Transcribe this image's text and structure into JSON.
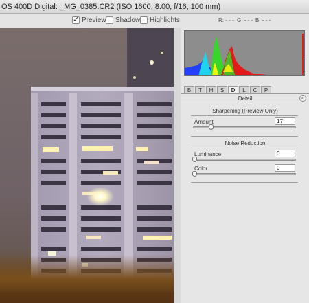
{
  "window": {
    "title": "OS 400D Digital:  _MG_0385.CR2  (ISO 1600, 8.00, f/16, 100 mm)"
  },
  "toolbar": {
    "preview": {
      "label": "Preview",
      "checked": true
    },
    "shadows": {
      "label": "Shadows",
      "checked": false
    },
    "highlights": {
      "label": "Highlights",
      "checked": false
    }
  },
  "readout": {
    "r": "R: - - -",
    "g": "G: - - -",
    "b": "B: - - -"
  },
  "tabs": [
    {
      "label": "B",
      "active": false
    },
    {
      "label": "T",
      "active": false
    },
    {
      "label": "H",
      "active": false
    },
    {
      "label": "S",
      "active": false
    },
    {
      "label": "D",
      "active": true
    },
    {
      "label": "L",
      "active": false
    },
    {
      "label": "C",
      "active": false
    },
    {
      "label": "P",
      "active": false
    }
  ],
  "detail": {
    "title": "Detail",
    "sharpening": {
      "title": "Sharpening  (Preview Only)",
      "amount_label": "Amount",
      "amount_value": "17",
      "amount_fraction": 0.17
    },
    "noise": {
      "title": "Noise Reduction",
      "luminance_label": "Luminance",
      "luminance_value": "0",
      "color_label": "Color",
      "color_value": "0"
    }
  },
  "colors": {
    "panel_bg": "#e6e6e6",
    "histogram_bg": "#8d8d8d",
    "hist_red": "#e21a1a",
    "hist_green": "#38d52a",
    "hist_cyan": "#20d4f0",
    "hist_blue": "#2340ff",
    "hist_yellow": "#f5f20f"
  }
}
